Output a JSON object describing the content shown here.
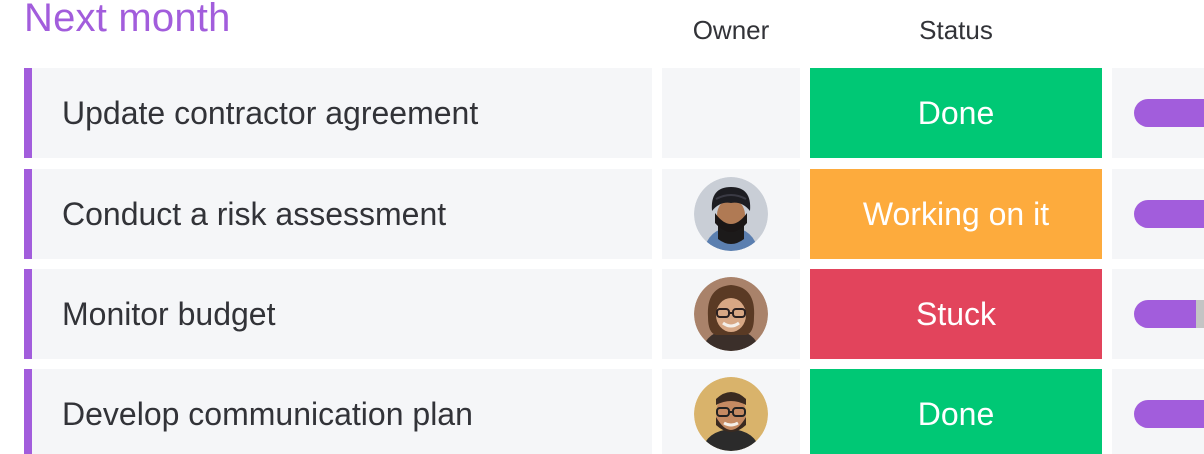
{
  "group": {
    "title": "Next month",
    "accent_color": "#a25ddc"
  },
  "columns": {
    "owner": "Owner",
    "status": "Status"
  },
  "status_colors": {
    "Done": "#00c875",
    "Working on it": "#fdab3d",
    "Stuck": "#e2445c"
  },
  "rows": [
    {
      "name": "Update contractor agreement",
      "owner": "",
      "status": "Done"
    },
    {
      "name": "Conduct a risk assessment",
      "owner": "avatar-man-turban",
      "status": "Working on it"
    },
    {
      "name": "Monitor budget",
      "owner": "avatar-woman-glasses",
      "status": "Stuck"
    },
    {
      "name": "Develop communication plan",
      "owner": "avatar-man-beard",
      "status": "Done"
    }
  ]
}
